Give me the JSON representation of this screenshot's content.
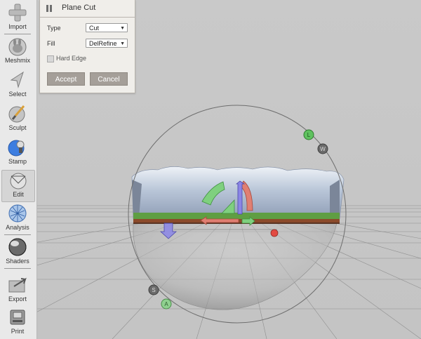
{
  "toolbar": {
    "items": [
      {
        "label": "Import",
        "icon": "plus-icon"
      },
      {
        "label": "Meshmix",
        "icon": "meshmix-bunny-icon"
      },
      {
        "label": "Select",
        "icon": "select-arrow-icon"
      },
      {
        "label": "Sculpt",
        "icon": "brush-icon"
      },
      {
        "label": "Stamp",
        "icon": "stamp-icon"
      },
      {
        "label": "Edit",
        "icon": "edit-sphere-icon",
        "active": true
      },
      {
        "label": "Analysis",
        "icon": "analysis-mesh-icon"
      },
      {
        "label": "Shaders",
        "icon": "shader-sphere-icon"
      },
      {
        "label": "Export",
        "icon": "export-icon"
      },
      {
        "label": "Print",
        "icon": "printer-icon"
      }
    ]
  },
  "panel": {
    "title": "Plane Cut",
    "type": {
      "label": "Type",
      "value": "Cut"
    },
    "fill": {
      "label": "Fill",
      "value": "DelRefine"
    },
    "hard_edge": {
      "label": "Hard Edge",
      "checked": false
    },
    "accept_label": "Accept",
    "cancel_label": "Cancel"
  },
  "gizmo_labels": {
    "handle_l": "L",
    "handle_w": "W",
    "handle_s": "S",
    "handle_a": "A"
  },
  "colors": {
    "background": "#c8c8c8",
    "panel_bg": "#f0eeea",
    "button": "#a59f99",
    "gizmo_green": "#7fd07f",
    "gizmo_red": "#d9655c",
    "gizmo_blue": "#7d78e0"
  }
}
